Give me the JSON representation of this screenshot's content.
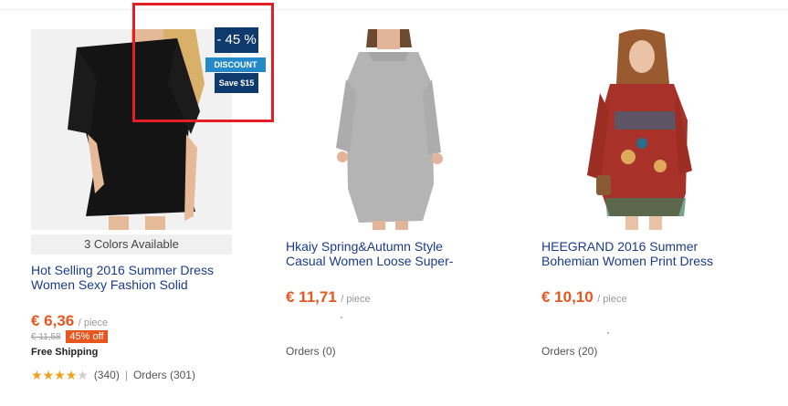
{
  "products": [
    {
      "colors_available": "3 Colors Available",
      "title_line1": "Hot Selling 2016 Summer Dress",
      "title_line2": "Women Sexy Fashion Solid",
      "price": "€ 6,36",
      "unit": "/ piece",
      "original_price": "€ 11,58",
      "discount_badge": "45% off",
      "free_shipping": "Free Shipping",
      "rating_stars": 4.5,
      "rating_count": "(340)",
      "orders": "Orders (301)",
      "dress_color": "#151515",
      "promo": {
        "percent": "- 45 %",
        "ribbon": "DISCOUNT",
        "save": "Save $15"
      }
    },
    {
      "title_line1": "Hkaiy Spring&Autumn Style",
      "title_line2": "Casual Women Loose Super-",
      "price": "€ 11,71",
      "unit": "/ piece",
      "orders": "Orders (0)",
      "dress_color": "#b8b8b8"
    },
    {
      "title_line1": "HEEGRAND 2016 Summer",
      "title_line2": "Bohemian Women Print Dress",
      "price": "€ 10,10",
      "unit": "/ piece",
      "orders": "Orders (20)",
      "dress_color": "#a8322a"
    }
  ],
  "colors": {
    "price": "#e8561f",
    "title_link": "#1a3c8a",
    "highlight": "#e31e24",
    "badge_navy": "#0f3a6e",
    "badge_blue": "#2489c9"
  }
}
